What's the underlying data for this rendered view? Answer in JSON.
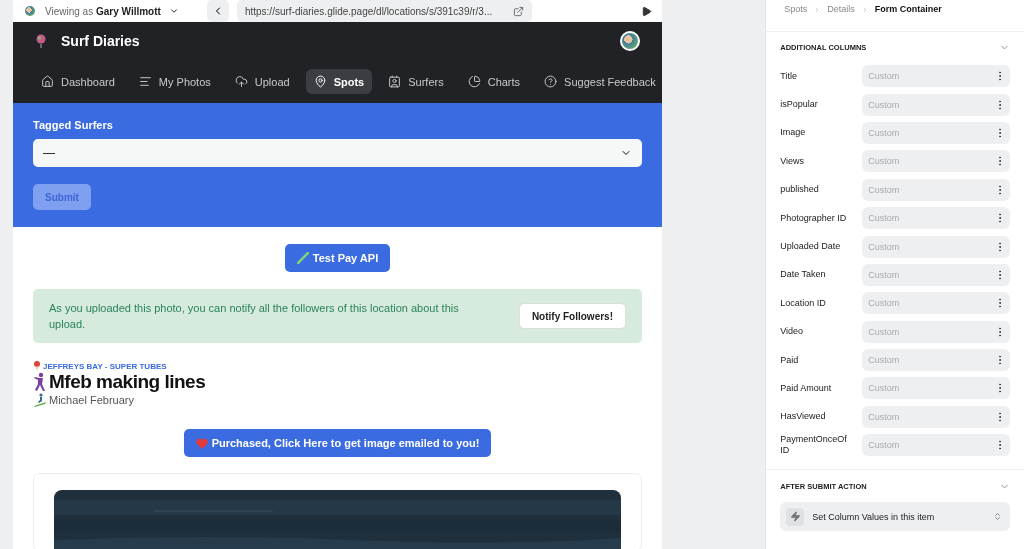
{
  "browser_bar": {
    "viewing_as_prefix": "Viewing as",
    "viewing_as_user": "Gary Willmott",
    "url": "https://surf-diaries.glide.page/dl/locations/s/391c39/r/3..."
  },
  "app": {
    "title": "Surf Diaries",
    "nav": [
      {
        "label": "Dashboard",
        "selected": false
      },
      {
        "label": "My Photos",
        "selected": false
      },
      {
        "label": "Upload",
        "selected": false
      },
      {
        "label": "Spots",
        "selected": true
      },
      {
        "label": "Surfers",
        "selected": false
      },
      {
        "label": "Charts",
        "selected": false
      },
      {
        "label": "Suggest Feedback",
        "selected": false
      }
    ]
  },
  "form": {
    "label": "Tagged Surfers",
    "value": "—",
    "submit": "Submit",
    "submit_disabled": true
  },
  "test_button": "Test Pay API",
  "notice": {
    "text": "As you uploaded this photo, you can notify all the followers of this location about this upload.",
    "button": "Notify Followers!"
  },
  "photo": {
    "location": "JEFFREYS BAY - SUPER TUBES",
    "title": "Mfeb making lines",
    "surfer": "Michael February",
    "purchase_button": "Purchased, Click Here to get image emailed to you!"
  },
  "panel": {
    "breadcrumb": [
      {
        "label": "Spots",
        "selected": false
      },
      {
        "label": "Details",
        "selected": false
      },
      {
        "label": "Form Container",
        "selected": true
      }
    ],
    "additional_columns": {
      "title": "ADDITIONAL COLUMNS",
      "rows": [
        {
          "label": "Title",
          "placeholder": "Custom"
        },
        {
          "label": "isPopular",
          "placeholder": "Custom"
        },
        {
          "label": "Image",
          "placeholder": "Custom"
        },
        {
          "label": "Views",
          "placeholder": "Custom"
        },
        {
          "label": "published",
          "placeholder": "Custom"
        },
        {
          "label": "Photographer ID",
          "placeholder": "Custom"
        },
        {
          "label": "Uploaded Date",
          "placeholder": "Custom"
        },
        {
          "label": "Date Taken",
          "placeholder": "Custom"
        },
        {
          "label": "Location ID",
          "placeholder": "Custom"
        },
        {
          "label": "Video",
          "placeholder": "Custom"
        },
        {
          "label": "Paid",
          "placeholder": "Custom"
        },
        {
          "label": "Paid Amount",
          "placeholder": "Custom"
        },
        {
          "label": "HasViewed",
          "placeholder": "Custom"
        },
        {
          "label": "PaymentOnceOf ID",
          "placeholder": "Custom"
        }
      ]
    },
    "after_submit": {
      "title": "AFTER SUBMIT ACTION",
      "value": "Set Column Values in this item"
    }
  }
}
